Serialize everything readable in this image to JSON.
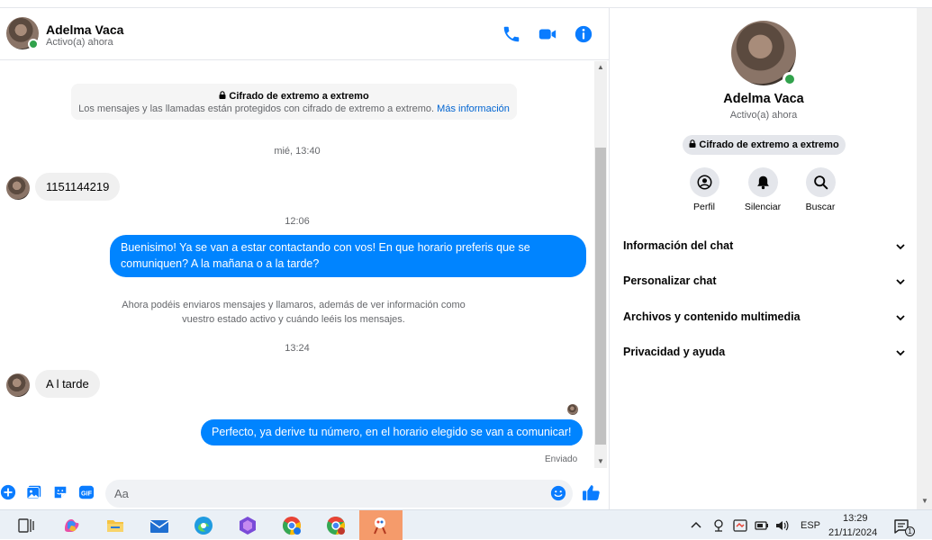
{
  "contact": {
    "name": "Adelma Vaca",
    "status": "Activo(a) ahora"
  },
  "encryption": {
    "title": "Cifrado de extremo a extremo",
    "description": "Los mensajes y las llamadas están protegidos con cifrado de extremo a extremo.",
    "link": "Más información"
  },
  "messages": {
    "ts1": "mié, 13:40",
    "m1": "1151144219",
    "ts2": "12:06",
    "m2_line1": "Buenisimo! Ya se van a estar contactando con vos! En que horario preferis que se",
    "m2_line2": "comuniquen? A la mañana o a la tarde?",
    "sys_line1": "Ahora podéis enviaros mensajes y llamaros, además de ver información como",
    "sys_line2": "vuestro estado activo y cuándo leéis los mensajes.",
    "ts3": "13:24",
    "m3": "A l tarde",
    "m4": "Perfecto, ya derive tu número, en el horario elegido se van a  comunicar!",
    "sent": "Enviado"
  },
  "composer": {
    "placeholder": "Aa"
  },
  "details": {
    "badge": "Cifrado de extremo a extremo",
    "actions": {
      "profile": "Perfil",
      "mute": "Silenciar",
      "search": "Buscar"
    },
    "sections": {
      "chat_info": "Información del chat",
      "customize": "Personalizar chat",
      "media": "Archivos y contenido multimedia",
      "privacy": "Privacidad y ayuda"
    }
  },
  "taskbar": {
    "language": "ESP",
    "time": "13:29",
    "date": "21/11/2024",
    "notifications": "1"
  },
  "colors": {
    "accent": "#0084ff",
    "icon_blue": "#0a7cff",
    "online": "#31a24c"
  }
}
